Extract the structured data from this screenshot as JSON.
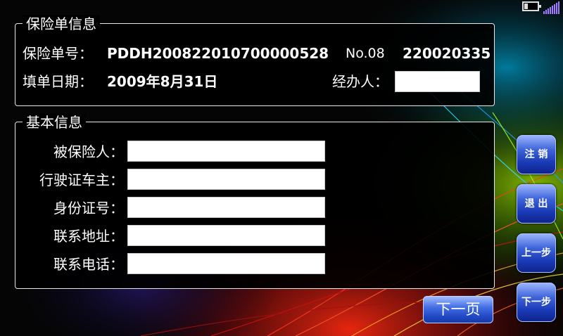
{
  "status": {
    "battery_icon": "battery-icon",
    "signal_icon": "signal-strength-icon",
    "battery_level": 0.25
  },
  "policy": {
    "legend": "保险单信息",
    "number_label": "保险单号：",
    "number_value": "PDDH200822010700000528",
    "no_label": "No.08",
    "no_value": "220020335",
    "date_label": "填单日期：",
    "date_value": "2009年8月31日",
    "agent_label": "经办人：",
    "agent_value": ""
  },
  "basic": {
    "legend": "基本信息",
    "fields": [
      {
        "label": "被保险人：",
        "value": ""
      },
      {
        "label": "行驶证车主：",
        "value": ""
      },
      {
        "label": "身份证号：",
        "value": ""
      },
      {
        "label": "联系地址：",
        "value": ""
      },
      {
        "label": "联系电话：",
        "value": ""
      }
    ]
  },
  "side_buttons": {
    "logout": "注 销",
    "exit": "退 出",
    "prev_step": "上一步",
    "next_step": "下一步"
  },
  "next_page": "下一页",
  "colors": {
    "button_blue": "#2a52d0",
    "panel_border": "#e8e8e8",
    "background": "#070707"
  }
}
